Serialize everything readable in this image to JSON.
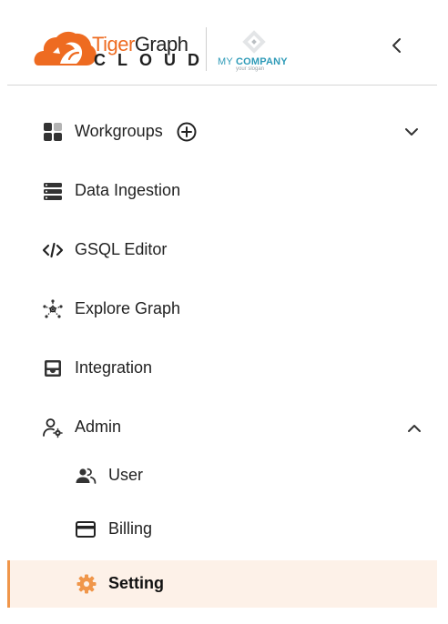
{
  "header": {
    "brand_tiger": "Tiger",
    "brand_graph": "Graph",
    "brand_cloud": "CLOUD",
    "company_my": "MY ",
    "company_bold": "COMPANY",
    "company_slogan": "your slogan"
  },
  "nav": {
    "workgroups": "Workgroups",
    "data_ingestion": "Data Ingestion",
    "gsql_editor": "GSQL Editor",
    "explore_graph": "Explore Graph",
    "integration": "Integration",
    "admin": "Admin",
    "admin_sub": {
      "user": "User",
      "billing": "Billing",
      "setting": "Setting"
    },
    "active_item": "Setting"
  },
  "colors": {
    "brand_orange": "#ee6b21",
    "active_bg": "#fdf1e8",
    "active_border": "#f0964a",
    "company_teal": "#2f9bb8"
  }
}
